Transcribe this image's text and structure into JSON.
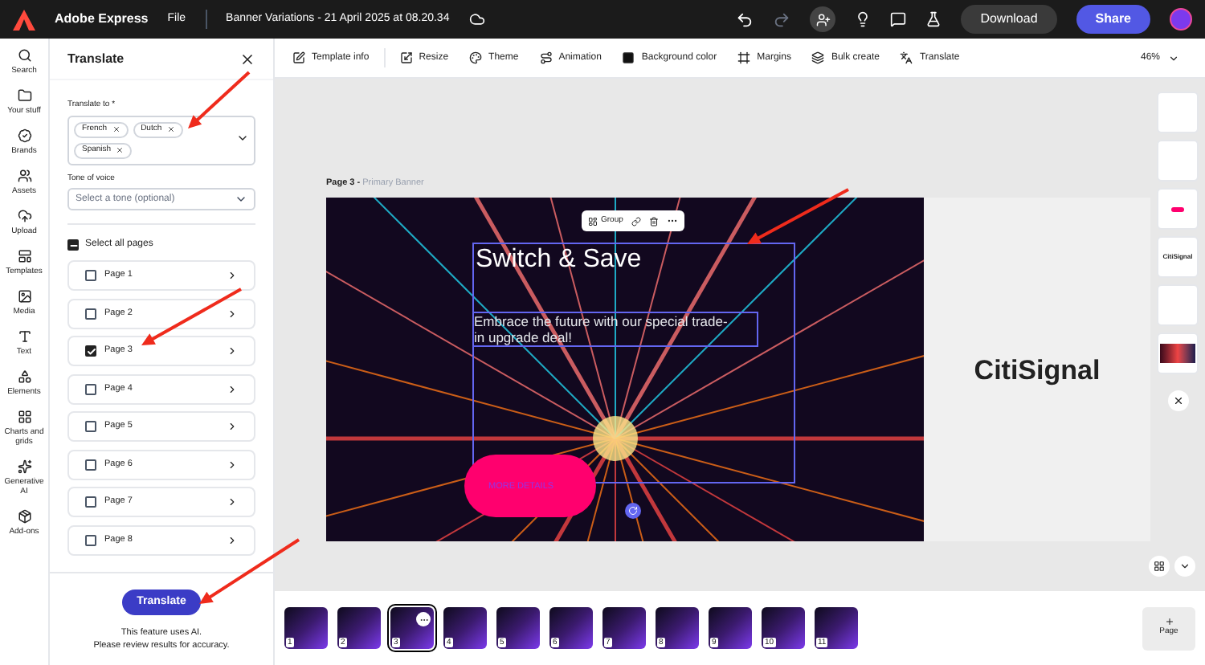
{
  "app": {
    "name": "Adobe Express",
    "menu": "File",
    "doc_title": "Banner Variations - 21 April 2025 at 08.20.34"
  },
  "header_buttons": [
    "Download",
    "Share"
  ],
  "rail": [
    {
      "kind": "search",
      "label": "Search"
    },
    {
      "kind": "folder",
      "label": "Your stuff"
    },
    {
      "kind": "brand",
      "label": "Brands"
    },
    {
      "kind": "assets",
      "label": "Assets"
    },
    {
      "kind": "upload",
      "label": "Upload"
    },
    {
      "kind": "templates",
      "label": "Templates"
    },
    {
      "kind": "media",
      "label": "Media"
    },
    {
      "kind": "text",
      "label": "Text"
    },
    {
      "kind": "elements",
      "label": "Elements"
    },
    {
      "kind": "charts",
      "label": "Charts and grids"
    },
    {
      "kind": "ai",
      "label": "Generative AI"
    },
    {
      "kind": "addons",
      "label": "Add-ons"
    }
  ],
  "panel": {
    "title": "Translate",
    "translate_to_label": "Translate to *",
    "languages": [
      "French",
      "Dutch",
      "Spanish"
    ],
    "tone_label": "Tone of voice",
    "tone_placeholder": "Select a tone (optional)",
    "select_all": {
      "label": "Select all pages",
      "indeterminate": true
    },
    "pages": [
      {
        "label": "Page 1",
        "checked": false
      },
      {
        "label": "Page 2",
        "checked": false
      },
      {
        "label": "Page 3",
        "checked": true
      },
      {
        "label": "Page 4",
        "checked": false
      },
      {
        "label": "Page 5",
        "checked": false
      },
      {
        "label": "Page 6",
        "checked": false
      },
      {
        "label": "Page 7",
        "checked": false
      },
      {
        "label": "Page 8",
        "checked": false
      }
    ],
    "button": "Translate",
    "note": [
      "This feature uses AI.",
      "Please review results for accuracy."
    ]
  },
  "toolbar": [
    {
      "kind": "info",
      "label": "Template info"
    },
    {
      "kind": "resize",
      "label": "Resize"
    },
    {
      "kind": "theme",
      "label": "Theme"
    },
    {
      "kind": "animation",
      "label": "Animation"
    },
    {
      "kind": "color",
      "label": "Background color"
    },
    {
      "kind": "margins",
      "label": "Margins"
    },
    {
      "kind": "bulk",
      "label": "Bulk create"
    },
    {
      "kind": "translate",
      "label": "Translate"
    }
  ],
  "zoom": "46%",
  "canvas": {
    "page_label": "Page 3 -",
    "page_name": "Primary Banner",
    "group_label": "Group",
    "headline": "Switch & Save",
    "body": "Embrace the future with our special trade-in upgrade deal!",
    "cta": "MORE DETAILS",
    "brand": "CitiSignal"
  },
  "side_thumbs": [
    {
      "kind": "blank"
    },
    {
      "kind": "blank"
    },
    {
      "kind": "pill"
    },
    {
      "kind": "logo",
      "text": "CitiSignal"
    },
    {
      "kind": "blank"
    },
    {
      "kind": "image"
    }
  ],
  "filmstrip": [
    {
      "number": "1",
      "selected": false
    },
    {
      "number": "2",
      "selected": false
    },
    {
      "number": "3",
      "selected": true
    },
    {
      "number": "4",
      "selected": false
    },
    {
      "number": "5",
      "selected": false
    },
    {
      "number": "6",
      "selected": false
    },
    {
      "number": "7",
      "selected": false
    },
    {
      "number": "8",
      "selected": false
    },
    {
      "number": "9",
      "selected": false
    },
    {
      "number": "10",
      "selected": false
    },
    {
      "number": "11",
      "selected": false
    }
  ],
  "add_page": "Page"
}
